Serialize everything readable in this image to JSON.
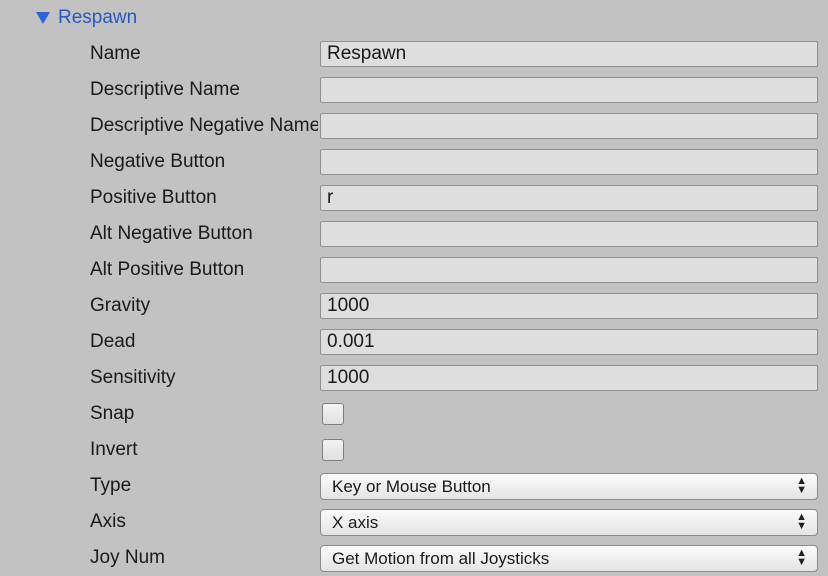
{
  "section": {
    "title": "Respawn",
    "expanded": true
  },
  "fields": {
    "name": {
      "label": "Name",
      "value": "Respawn"
    },
    "descriptive_name": {
      "label": "Descriptive Name",
      "value": ""
    },
    "descriptive_negative_name": {
      "label": "Descriptive Negative Name",
      "value": ""
    },
    "negative_button": {
      "label": "Negative Button",
      "value": ""
    },
    "positive_button": {
      "label": "Positive Button",
      "value": "r"
    },
    "alt_negative_button": {
      "label": "Alt Negative Button",
      "value": ""
    },
    "alt_positive_button": {
      "label": "Alt Positive Button",
      "value": ""
    },
    "gravity": {
      "label": "Gravity",
      "value": "1000"
    },
    "dead": {
      "label": "Dead",
      "value": "0.001"
    },
    "sensitivity": {
      "label": "Sensitivity",
      "value": "1000"
    },
    "snap": {
      "label": "Snap",
      "checked": false
    },
    "invert": {
      "label": "Invert",
      "checked": false
    },
    "type": {
      "label": "Type",
      "value": "Key or Mouse Button"
    },
    "axis": {
      "label": "Axis",
      "value": "X axis"
    },
    "joy_num": {
      "label": "Joy Num",
      "value": "Get Motion from all Joysticks"
    }
  },
  "icons": {
    "foldout": "triangle-down-icon",
    "dropdown": "up-down-arrows-icon"
  },
  "colors": {
    "background": "#c2c2c2",
    "accent": "#2f63d8",
    "field_bg": "#dedede"
  }
}
